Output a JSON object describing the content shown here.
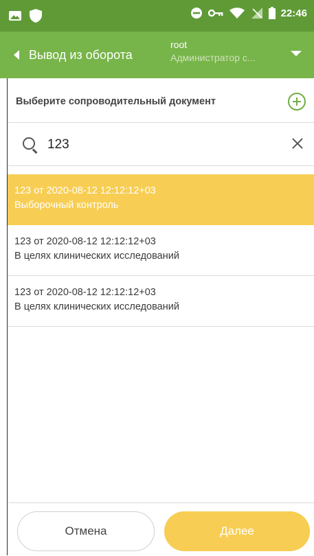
{
  "status_bar": {
    "time": "22:46",
    "icons": [
      "image-icon",
      "shield-icon",
      "do-not-disturb-icon",
      "key-icon",
      "wifi-icon",
      "no-sim-icon",
      "battery-icon"
    ]
  },
  "app_bar": {
    "title": "Вывод из оборота",
    "user_name": "root",
    "user_role": "Администратор с...",
    "color": "#77b449"
  },
  "section": {
    "title": "Выберите сопроводительный документ"
  },
  "search": {
    "value": "123"
  },
  "documents": [
    {
      "line1": "123 от 2020-08-12 12:12:12+03",
      "line2": "Выборочный контроль",
      "selected": true
    },
    {
      "line1": "123 от 2020-08-12 12:12:12+03",
      "line2": "В целях клинических исследований",
      "selected": false
    },
    {
      "line1": "123 от 2020-08-12 12:12:12+03",
      "line2": "В целях клинических исследований",
      "selected": false
    }
  ],
  "footer": {
    "cancel_label": "Отмена",
    "next_label": "Далее"
  },
  "colors": {
    "accent_green": "#77b449",
    "selected_yellow": "#f7cd53"
  }
}
